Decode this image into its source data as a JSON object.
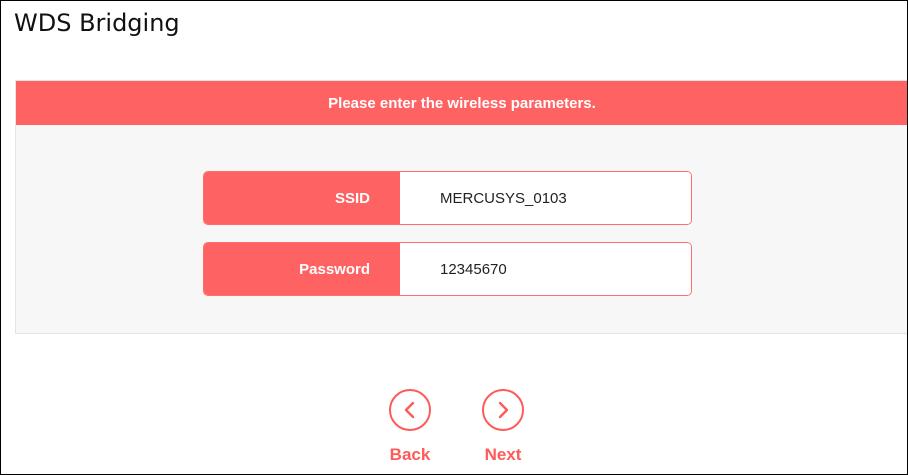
{
  "page": {
    "title": "WDS Bridging"
  },
  "panel": {
    "header": "Please enter the wireless parameters."
  },
  "fields": {
    "ssid": {
      "label": "SSID",
      "value": "MERCUSYS_0103"
    },
    "password": {
      "label": "Password",
      "value": "12345670"
    }
  },
  "nav": {
    "back_label": "Back",
    "next_label": "Next",
    "back_icon": "chevron-left-icon",
    "next_icon": "chevron-right-icon"
  },
  "colors": {
    "accent": "#ff6262",
    "panel_bg": "#f7f7f7"
  }
}
